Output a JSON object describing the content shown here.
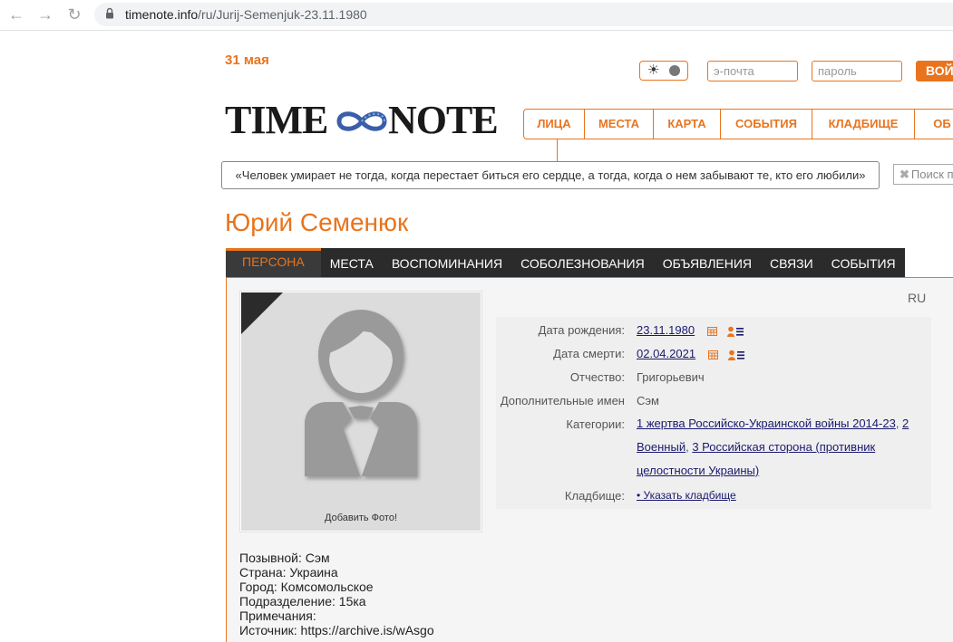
{
  "browser": {
    "url_domain": "timenote.info",
    "url_path": "/ru/Jurij-Semenjuk-23.11.1980"
  },
  "header": {
    "date": "31 мая",
    "email_placeholder": "э-почта",
    "password_placeholder": "пароль",
    "login_label": "ВОЙ",
    "logo_left": "TIME",
    "logo_right": "NOTE"
  },
  "nav": {
    "items": [
      {
        "label": "ЛИЦА"
      },
      {
        "label": "МЕСТА"
      },
      {
        "label": "КАРТА"
      },
      {
        "label": "СОБЫТИЯ"
      },
      {
        "label": "КЛАДБИЩЕ"
      },
      {
        "label": "ОБ"
      }
    ]
  },
  "quote": "«Человек умирает не тогда, когда перестает биться его сердце, а тогда, когда о нем забывают те, кто его любили»",
  "search_placeholder": "Поиск п",
  "person": {
    "name": "Юрий Семенюк",
    "lang": "RU",
    "add_photo": "Добавить Фото!"
  },
  "tabs": [
    {
      "label": "ПЕРСОНА",
      "active": true
    },
    {
      "label": "МЕСТА"
    },
    {
      "label": "ВОСПОМИНАНИЯ"
    },
    {
      "label": "СОБОЛЕЗНОВАНИЯ"
    },
    {
      "label": "ОБЪЯВЛЕНИЯ"
    },
    {
      "label": "СВЯЗИ"
    },
    {
      "label": "СОБЫТИЯ"
    }
  ],
  "details": {
    "birth_label": "Дата рождения:",
    "birth_value": "23.11.1980",
    "death_label": "Дата смерти:",
    "death_value": "02.04.2021",
    "patronymic_label": "Отчество:",
    "patronymic_value": "Григорьевич",
    "extra_names_label": "Дополнительные имен",
    "extra_names_value": "Сэм",
    "categories_label": "Категории:",
    "category_1a": "1 жертва Российско-Украинской войны 2014-23",
    "category_1b": "2",
    "category_2a": "Военный",
    "category_3a": "3 Российская сторона (противник",
    "category_3b": "целостности Украины)",
    "cemetery_label": "Кладбище:",
    "cemetery_value": "• Указать кладбище"
  },
  "bio": [
    "Позывной: Сэм",
    "Страна: Украина",
    "Город: Комсомольское",
    "Подразделение: 15ка",
    "Примечания:",
    "Источник: https://archive.is/wAsgo"
  ],
  "colors": {
    "accent": "#e8741e",
    "dark_tabs": "#2b2b2b",
    "link": "#1a1a6e"
  }
}
